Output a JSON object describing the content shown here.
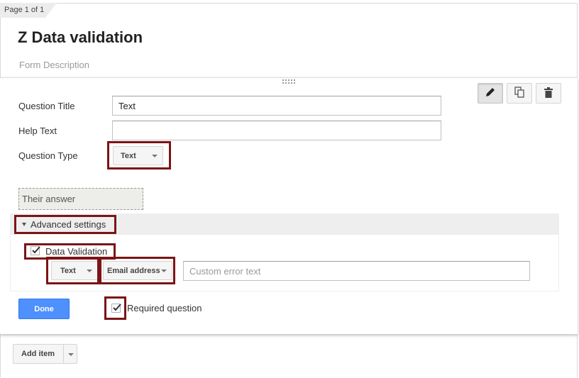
{
  "page_indicator": "Page 1 of 1",
  "form": {
    "title": "Z Data validation",
    "description_placeholder": "Form Description"
  },
  "toolbar": {
    "edit_icon": "pencil-icon",
    "duplicate_icon": "duplicate-icon",
    "delete_icon": "trash-icon"
  },
  "question": {
    "title_label": "Question Title",
    "title_value": "Text",
    "help_label": "Help Text",
    "help_value": "",
    "type_label": "Question Type",
    "type_value": "Text",
    "answer_preview": "Their answer"
  },
  "advanced": {
    "toggle_label": "Advanced settings",
    "data_validation_label": "Data Validation",
    "data_validation_checked": true,
    "validation_type": "Text",
    "validation_rule": "Email address",
    "error_placeholder": "Custom error text"
  },
  "footer": {
    "done_label": "Done",
    "required_label": "Required question",
    "required_checked": true,
    "add_item_label": "Add item"
  },
  "colors": {
    "highlight": "#7b1416",
    "done_button": "#4d90fe"
  }
}
